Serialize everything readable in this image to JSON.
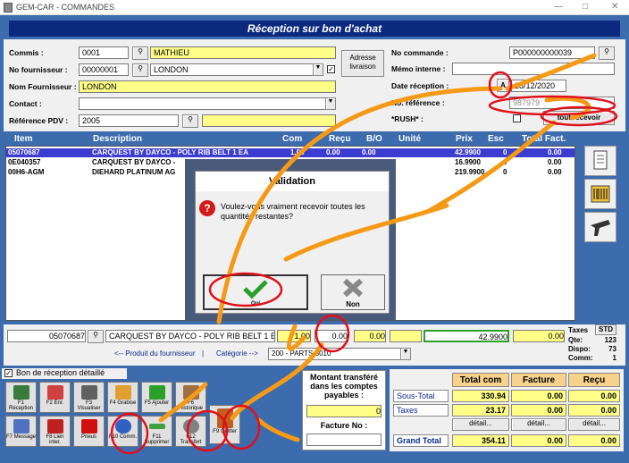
{
  "window": {
    "title": "GEM-CAR - COMMANDES"
  },
  "header": {
    "title": "Réception sur bon d'achat"
  },
  "left_form": {
    "commis_label": "Commis :",
    "commis_code": "0001",
    "commis_name": "MATHIEU",
    "fournisseur_label": "No fournisseur :",
    "fournisseur_code": "00000001",
    "fournisseur_name": "LONDON",
    "nom_fournisseur_label": "Nom Fournisseur :",
    "nom_fournisseur_value": "LONDON",
    "contact_label": "Contact :",
    "contact_value": "",
    "pdv_label": "Référence PDV :",
    "pdv_value": "2005",
    "adresse_button": "Adresse livraison",
    "checkbox_mark": "✓"
  },
  "right_form": {
    "no_commande_label": "No commande :",
    "no_commande_value": "P000000000039",
    "memo_label": "Mémo interne :",
    "memo_value": "",
    "date_label": "Date réception :",
    "date_btn": "A",
    "date_value": "28/12/2020",
    "reference_label": "No. référence :",
    "reference_value": "987979",
    "rush_label": "*RUSH* :",
    "tout_recevoir_button": "tout recevoir"
  },
  "grid": {
    "columns": [
      "Item",
      "Description",
      "Com",
      "Reçu",
      "B/O",
      "Unité",
      "Prix",
      "Esc",
      "Total Fact."
    ],
    "rows": [
      {
        "item": "05070687",
        "description": "CARQUEST BY DAYCO - POLY RIB BELT 1 EA",
        "com": "1.00",
        "recu": "0.00",
        "bo": "0.00",
        "prix": "42.9900",
        "esc": "0",
        "total": "0.00"
      },
      {
        "item": "0E040357",
        "description": "CARQUEST BY DAYCO -",
        "com": "",
        "recu": "",
        "bo": "",
        "prix": "16.9900",
        "esc": "0",
        "total": "0.00"
      },
      {
        "item": "00H6-AGM",
        "description": "DIEHARD PLATINUM AG",
        "com": "",
        "recu": "",
        "bo": "",
        "prix": "219.9900",
        "esc": "0",
        "total": "0.00"
      }
    ]
  },
  "dialog": {
    "title": "Validation",
    "message": "Voulez-vous vraiment recevoir toutes les quantités restantes?",
    "yes_label": "Oui",
    "no_label": "Non"
  },
  "detail_row": {
    "item": "05070687",
    "description": "CARQUEST BY DAYCO - POLY RIB BELT 1 E",
    "com": "1.00",
    "recu": "0.00",
    "bo": "0.00",
    "prix": "42.9900",
    "total": "0.00",
    "produit_link": "<-- Produit du fournisseur",
    "separator": "|",
    "categorie_link": "Catégorie -->",
    "categorie_value": "200 - PARTS 5010",
    "taxes_label": "Taxes",
    "std_button": "STD",
    "qte_label": "Qte:",
    "qte_value": "123",
    "dispo_label": "Dispo:",
    "dispo_value": "73",
    "comm_label": "Comm:",
    "comm_value": "1"
  },
  "detail_check": {
    "label": "Bon de réception détaillé",
    "mark": "✓"
  },
  "fkeys": [
    {
      "label": "F1 Réception",
      "color": "#3a7a3a"
    },
    {
      "label": "F2 Enr.",
      "color": "#d04040"
    },
    {
      "label": "F3 Visualiser",
      "color": "#606060"
    },
    {
      "label": "F4 Grabise",
      "color": "#e0a030"
    },
    {
      "label": "F5 Ajouter",
      "color": "#2aa02a"
    },
    {
      "label": "F6 Historique",
      "color": "#a07040"
    },
    {
      "label": "F7 Message",
      "color": "#5070c0"
    },
    {
      "label": "F8 Lien inter.",
      "color": "#c02020"
    },
    {
      "label": "Pneus",
      "color": "#d01010"
    },
    {
      "label": "F10 Comm.",
      "color": "#3060c0"
    },
    {
      "label": "F11 Supprimer",
      "color": "#40a040"
    },
    {
      "label": "F12 Transfert",
      "color": "#808080"
    },
    {
      "label": "F9 Quitter",
      "color": "#c06020"
    }
  ],
  "montant": {
    "label": "Montant transféré dans les comptes payables :",
    "value": "0",
    "facture_label": "Facture No :",
    "facture_value": ""
  },
  "totals": {
    "headers": [
      "Total com",
      "Facture",
      "Reçu"
    ],
    "sous_total_label": "Sous-Total",
    "sous_total": [
      "330.94",
      "0.00",
      "0.00"
    ],
    "taxes_label": "Taxes",
    "taxes": [
      "23.17",
      "0.00",
      "0.00"
    ],
    "detail_label": "détail...",
    "grand_total_label": "Grand Total",
    "grand_total": [
      "354.11",
      "0.00",
      "0.00"
    ]
  }
}
